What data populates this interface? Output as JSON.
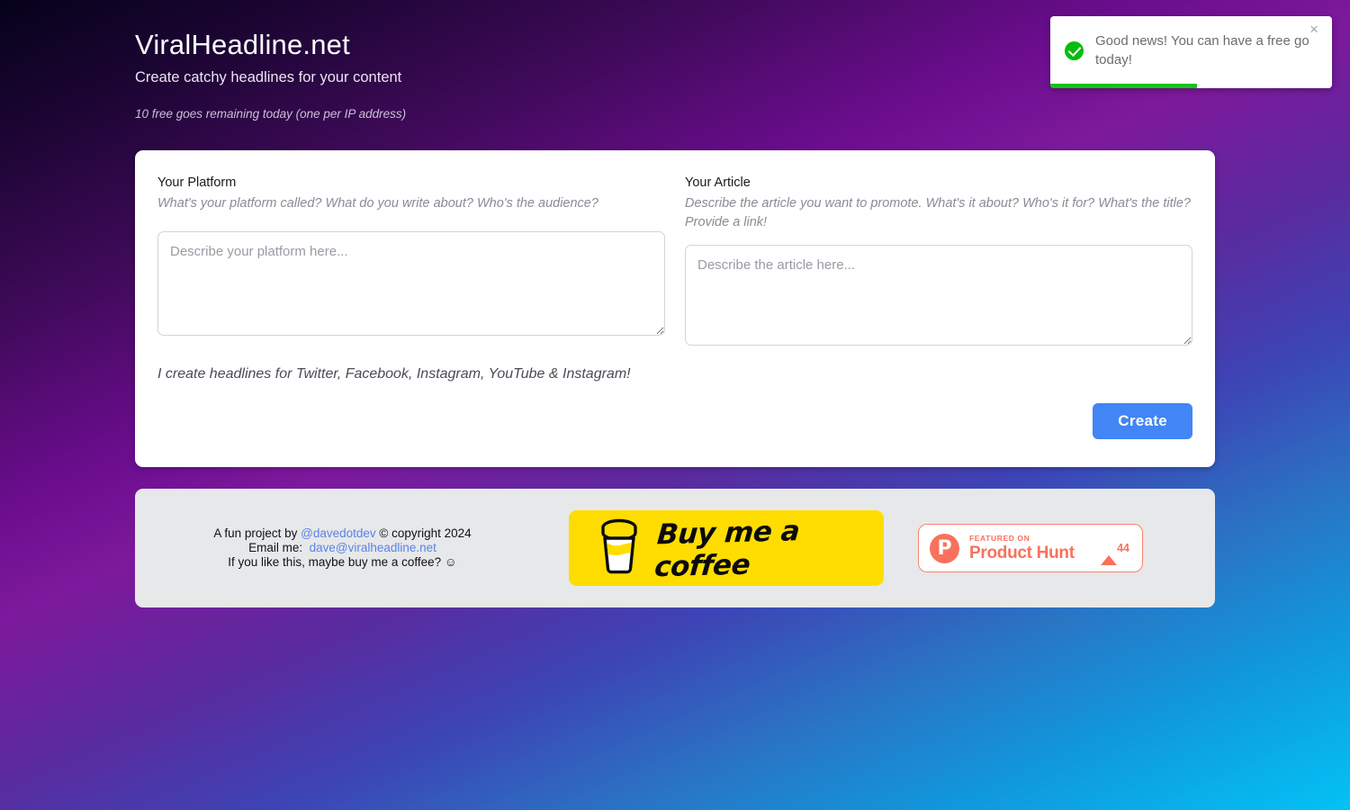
{
  "header": {
    "title": "ViralHeadline.net",
    "subtitle": "Create catchy headlines for your content",
    "free_goes": "10 free goes remaining today (one per IP address)"
  },
  "toast": {
    "message": "Good news! You can have a free go today!",
    "close_label": "×",
    "icon": "success-check-icon",
    "progress_percent": 52,
    "accent_color": "#07bc0c"
  },
  "form": {
    "platform": {
      "label": "Your Platform",
      "hint": "What's your platform called? What do you write about? Who's the audience?",
      "placeholder": "Describe your platform here...",
      "value": ""
    },
    "article": {
      "label": "Your Article",
      "hint": "Describe the article you want to promote. What's it about? Who's it for? What's the title? Provide a link!",
      "placeholder": "Describe the article here...",
      "value": ""
    },
    "tagline": "I create headlines for Twitter, Facebook, Instagram, YouTube & Instagram!",
    "create_label": "Create",
    "create_color": "#4285f4"
  },
  "footer": {
    "credit_prefix": "A fun project by ",
    "credit_handle": "@davedotdev",
    "credit_suffix": " © copyright 2024",
    "email_label": "Email me:",
    "email_address": "dave@viralheadline.net",
    "coffee_line": "If you like this, maybe buy me a coffee? ☺",
    "link_color": "#5a83e8",
    "bmc": {
      "label": "Buy me a coffee",
      "bg_color": "#ffdd00",
      "icon": "coffee-cup-icon"
    },
    "product_hunt": {
      "featured_on": "FEATURED ON",
      "name": "Product Hunt",
      "upvotes": "44",
      "logo_letter": "P",
      "accent_color": "#f9715b"
    }
  }
}
